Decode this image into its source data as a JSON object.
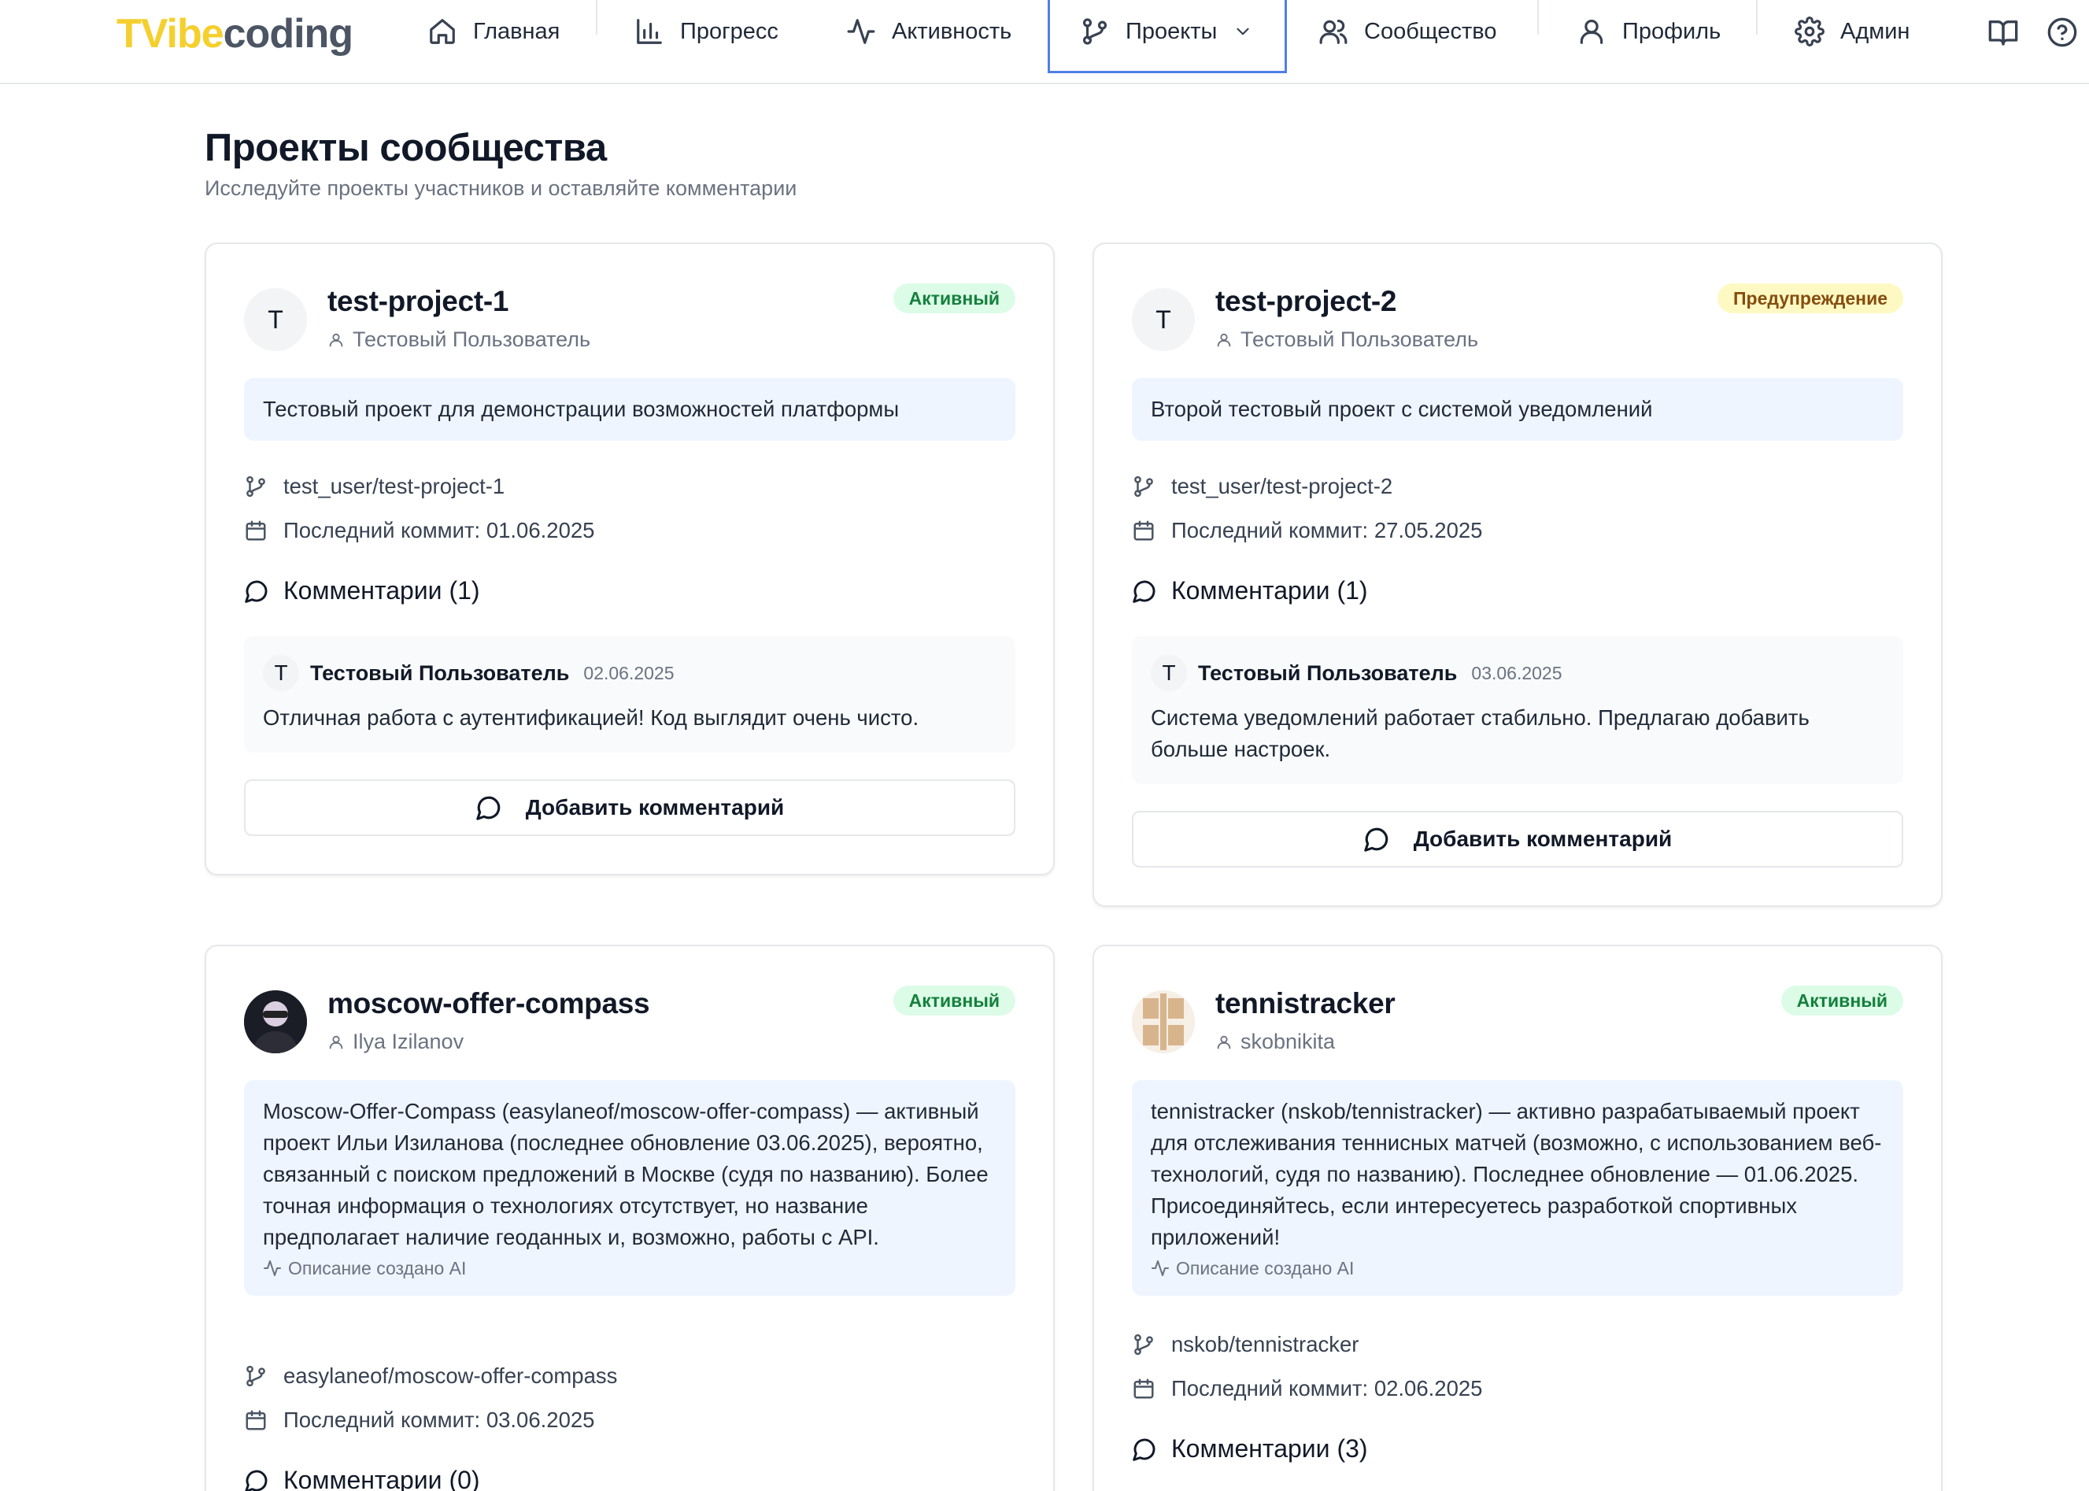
{
  "logo": {
    "part1": "TVibe",
    "part2": "coding"
  },
  "nav": {
    "home": "Главная",
    "progress": "Прогресс",
    "activity": "Активность",
    "projects": "Проекты",
    "community": "Сообщество",
    "profile": "Профиль",
    "admin": "Админ"
  },
  "page": {
    "title": "Проекты сообщества",
    "subtitle": "Исследуйте проекты участников и оставляйте комментарии"
  },
  "colors": {
    "accent": "#4f7fe8",
    "logo_yellow": "#f5cf2d",
    "badge_green": "#dcfce7",
    "badge_yellow": "#fef9c3",
    "desc_bg": "#eff5ff"
  },
  "cards": [
    {
      "avatar_letter": "T",
      "name": "test-project-1",
      "owner": "Тестовый Пользователь",
      "status": "Активный",
      "description": "Тестовый проект для демонстрации возможностей платформы",
      "repo": "test_user/test-project-1",
      "last_commit": "Последний коммит: 01.06.2025",
      "comments_title": "Комментарии (1)",
      "comment": {
        "avatar_letter": "T",
        "author": "Тестовый Пользователь",
        "date": "02.06.2025",
        "text": "Отличная работа с аутентификацией! Код выглядит очень чисто."
      },
      "add_comment": "Добавить комментарий"
    },
    {
      "avatar_letter": "T",
      "name": "test-project-2",
      "owner": "Тестовый Пользователь",
      "status": "Предупреждение",
      "description": "Второй тестовый проект с системой уведомлений",
      "repo": "test_user/test-project-2",
      "last_commit": "Последний коммит: 27.05.2025",
      "comments_title": "Комментарии (1)",
      "comment": {
        "avatar_letter": "T",
        "author": "Тестовый Пользователь",
        "date": "03.06.2025",
        "text": "Система уведомлений работает стабильно. Предлагаю добавить больше настроек."
      },
      "add_comment": "Добавить комментарий"
    },
    {
      "name": "moscow-offer-compass",
      "owner": "Ilya Izilanov",
      "status": "Активный",
      "description": "Moscow-Offer-Compass (easylaneof/moscow-offer-compass) — активный проект Ильи Изиланова (последнее обновление 03.06.2025), вероятно, связанный с поиском предложений в Москве (судя по названию). Более точная информация о технологиях отсутствует, но название предполагает наличие геоданных и, возможно, работы с API.",
      "ai_note": "Описание создано AI",
      "repo": "easylaneof/moscow-offer-compass",
      "last_commit": "Последний коммит: 03.06.2025",
      "comments_title": "Комментарии (0)"
    },
    {
      "name": "tennistracker",
      "owner": "skobnikita",
      "status": "Активный",
      "description": "tennistracker (nskob/tennistracker) — активно разрабатываемый проект для отслеживания теннисных матчей (возможно, с использованием веб-технологий, судя по названию). Последнее обновление — 01.06.2025. Присоединяйтесь, если интересуетесь разработкой спортивных приложений!",
      "ai_note": "Описание создано AI",
      "repo": "nskob/tennistracker",
      "last_commit": "Последний коммит: 02.06.2025",
      "comments_title": "Комментарии (3)"
    }
  ]
}
